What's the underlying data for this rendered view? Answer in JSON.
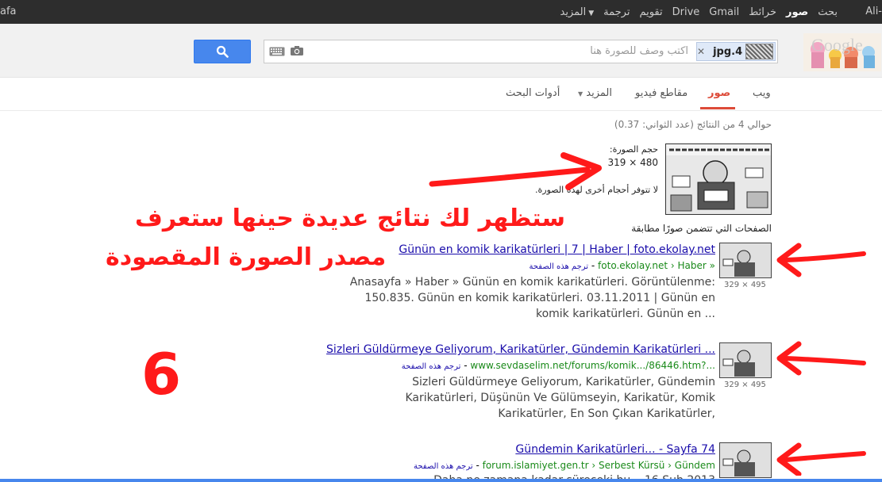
{
  "topbar": {
    "left_user": "afa",
    "right_user": "Ali-",
    "nav": [
      {
        "label": "بحث",
        "active": false
      },
      {
        "label": "صور",
        "active": true
      },
      {
        "label": "خرائط",
        "active": false
      },
      {
        "label": "Gmail",
        "active": false
      },
      {
        "label": "Drive",
        "active": false
      },
      {
        "label": "تقويم",
        "active": false
      },
      {
        "label": "ترجمة",
        "active": false
      },
      {
        "label": "المزيد",
        "active": false
      }
    ]
  },
  "search": {
    "file_chip": "jpg.4",
    "placeholder": "اكتب وصف للصورة هنا"
  },
  "tabs": {
    "web": "ويب",
    "images": "صور",
    "videos": "مقاطع فيديو",
    "more": "المزيد",
    "tools": "أدوات البحث"
  },
  "result_stats": "حوالي 4 من النتائج (عدد الثواني: 0.37)",
  "image_info": {
    "size_label": "حجم الصورة:",
    "size_value": "319 × 480",
    "no_other_sizes": "لا تتوفر أحجام أخرى لهذه الصورة."
  },
  "pages_heading": "الصفحات التي تتضمن صورًا مطابقة",
  "results": [
    {
      "title": "Günün en komik karikatürleri | 7 | Haber | foto.ekolay.net",
      "url": "foto.ekolay.net › Haber »",
      "translate": "ترجم هذه الصفحة",
      "dims": "329 × 495",
      "snippet": "Anasayfa » Haber » Günün en komik karikatürleri. Görüntülenme: 150.835. Günün en komik karikatürleri. 03.11.2011 | Günün en komik karikatürleri. Günün en ..."
    },
    {
      "title": "Sizleri Güldürmeye Geliyorum, Karikatürler, Gündemin Karikatürleri ...",
      "url": "www.sevdaselim.net/forums/komik.../86446.htm?...",
      "translate": "ترجم هذه الصفحة",
      "dims": "329 × 495",
      "snippet": "Sizleri Güldürmeye Geliyorum, Karikatürler, Gündemin Karikatürleri, Düşünün Ve Gülümseyin, Karikatür, Komik Karikatürler, En Son Çıkan Karikatürler,"
    },
    {
      "title": "Gündemin Karikatürleri... - Sayfa 74",
      "url": "forum.islamiyet.gen.tr › Serbest Kürsü › Gündem",
      "translate": "ترجم هذه الصفحة",
      "dims": "",
      "snippet": "Daha ne zamana kadar süreceki bu... 16 Şub 2013"
    }
  ],
  "annotations": {
    "line1": "ستظهر لك نتائج عديدة حينها ستعرف",
    "line2": "مصدر الصورة المقصودة",
    "number": "6"
  },
  "colors": {
    "annotation": "#ff1a1a",
    "link": "#1a0dab",
    "url": "#1a8a1a",
    "active_tab": "#dd4b39",
    "search_button": "#4787ed"
  }
}
